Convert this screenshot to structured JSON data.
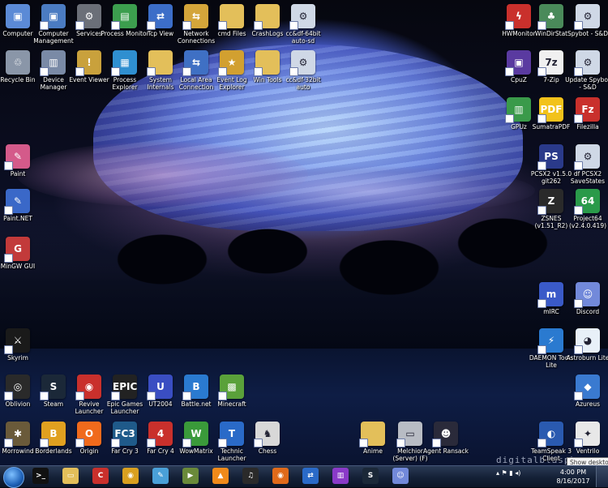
{
  "desktop": {
    "watermark": "digitalblasphe",
    "icons": [
      {
        "label": "Computer",
        "icon": "computer-icon",
        "color": "#5b8ad6",
        "glyph": "▣"
      },
      {
        "label": "Computer Management",
        "icon": "computer-management-icon",
        "color": "#4b7cc2",
        "glyph": "▣"
      },
      {
        "label": "Services",
        "icon": "gears-icon",
        "color": "#6b6f78",
        "glyph": "⚙"
      },
      {
        "label": "Process Monitor",
        "icon": "process-monitor-icon",
        "color": "#3c9e4e",
        "glyph": "▤"
      },
      {
        "label": "Tcp View",
        "icon": "network-icon",
        "color": "#3c6ec8",
        "glyph": "⇄"
      },
      {
        "label": "Network Connections",
        "icon": "network-connections-icon",
        "color": "#d4a53a",
        "glyph": "⇆"
      },
      {
        "label": "cmd Files",
        "icon": "folder-icon",
        "color": "#e3bf5a",
        "glyph": ""
      },
      {
        "label": "CrashLogs",
        "icon": "folder-icon",
        "color": "#e3bf5a",
        "glyph": ""
      },
      {
        "label": "cc&df-64bit auto-sd",
        "icon": "script-icon",
        "color": "#cfd8e6",
        "glyph": "⚙"
      },
      {
        "label": "Recycle Bin",
        "icon": "recycle-bin-icon",
        "color": "#8a96a8",
        "glyph": "♲"
      },
      {
        "label": "Device Manager",
        "icon": "device-manager-icon",
        "color": "#7a8aa6",
        "glyph": "▥"
      },
      {
        "label": "Event Viewer",
        "icon": "event-viewer-icon",
        "color": "#c9a13c",
        "glyph": "!"
      },
      {
        "label": "Process Explorer",
        "icon": "process-explorer-icon",
        "color": "#2f8fd0",
        "glyph": "▦"
      },
      {
        "label": "System Internals",
        "icon": "folder-icon",
        "color": "#e3bf5a",
        "glyph": ""
      },
      {
        "label": "Local Area Connection",
        "icon": "lan-icon",
        "color": "#3f70c4",
        "glyph": "⇆"
      },
      {
        "label": "Event Log Explorer",
        "icon": "event-log-icon",
        "color": "#d2a030",
        "glyph": "★"
      },
      {
        "label": "Win Tools",
        "icon": "folder-icon",
        "color": "#e3bf5a",
        "glyph": ""
      },
      {
        "label": "cc&df-32bit auto",
        "icon": "script-icon",
        "color": "#cfd8e6",
        "glyph": "⚙"
      },
      {
        "label": "Paint",
        "icon": "paint-icon",
        "color": "#d45a8a",
        "glyph": "✎"
      },
      {
        "label": "Paint.NET",
        "icon": "paintnet-icon",
        "color": "#3a68c8",
        "glyph": "✎"
      },
      {
        "label": "MinGW GUI",
        "icon": "mingw-icon",
        "color": "#c23a3a",
        "glyph": "G"
      },
      {
        "label": "Skyrim",
        "icon": "skyrim-icon",
        "color": "#1a1a1a",
        "glyph": "⚔"
      },
      {
        "label": "Oblivion",
        "icon": "oblivion-icon",
        "color": "#2a2a2a",
        "glyph": "◎"
      },
      {
        "label": "Steam",
        "icon": "steam-icon",
        "color": "#1b2838",
        "glyph": "S"
      },
      {
        "label": "Revive Launcher",
        "icon": "revive-icon",
        "color": "#c9302c",
        "glyph": "◉"
      },
      {
        "label": "Epic Games Launcher",
        "icon": "epic-icon",
        "color": "#222",
        "glyph": "EPIC"
      },
      {
        "label": "UT2004",
        "icon": "ut2004-icon",
        "color": "#3a4ec2",
        "glyph": "U"
      },
      {
        "label": "Battle.net",
        "icon": "battlenet-icon",
        "color": "#2a7ad0",
        "glyph": "B"
      },
      {
        "label": "Minecraft",
        "icon": "minecraft-icon",
        "color": "#5aa13a",
        "glyph": "▩"
      },
      {
        "label": "Morrowind",
        "icon": "morrowind-icon",
        "color": "#6a5a3a",
        "glyph": "✱"
      },
      {
        "label": "Borderlands",
        "icon": "borderlands-icon",
        "color": "#e0a020",
        "glyph": "B"
      },
      {
        "label": "Origin",
        "icon": "origin-icon",
        "color": "#f06a1c",
        "glyph": "O"
      },
      {
        "label": "Far Cry 3",
        "icon": "farcry3-icon",
        "color": "#1f5a8a",
        "glyph": "FC3"
      },
      {
        "label": "Far Cry 4",
        "icon": "farcry4-icon",
        "color": "#c9302c",
        "glyph": "4"
      },
      {
        "label": "WowMatrix",
        "icon": "wowmatrix-icon",
        "color": "#3a9a3a",
        "glyph": "W"
      },
      {
        "label": "Technic Launcher",
        "icon": "technic-icon",
        "color": "#2a6ac8",
        "glyph": "T"
      },
      {
        "label": "Chess",
        "icon": "chess-icon",
        "color": "#d8d8d8",
        "glyph": "♞"
      },
      {
        "label": "Anime",
        "icon": "folder-icon",
        "color": "#e3bf5a",
        "glyph": ""
      },
      {
        "label": "Melchior (Server) (F)",
        "icon": "drive-icon",
        "color": "#b8bcc4",
        "glyph": "▭"
      },
      {
        "label": "Agent Ransack",
        "icon": "agent-ransack-icon",
        "color": "#2a2a3a",
        "glyph": "☻"
      },
      {
        "label": "HWMonitor",
        "icon": "hwmonitor-icon",
        "color": "#c9302c",
        "glyph": "ϟ"
      },
      {
        "label": "WinDirStat",
        "icon": "windirstat-icon",
        "color": "#4a8a5a",
        "glyph": "♣"
      },
      {
        "label": "Spybot - S&D",
        "icon": "spybot-icon",
        "color": "#cfd8e6",
        "glyph": "⚙"
      },
      {
        "label": "CpuZ",
        "icon": "cpuz-icon",
        "color": "#5a3aa0",
        "glyph": "▣"
      },
      {
        "label": "7-Zip",
        "icon": "7zip-icon",
        "color": "#f0f0f0",
        "glyph": "7z"
      },
      {
        "label": "Update Spybot - S&D",
        "icon": "spybot-update-icon",
        "color": "#cfd8e6",
        "glyph": "⚙"
      },
      {
        "label": "GPUz",
        "icon": "gpuz-icon",
        "color": "#3a9a4a",
        "glyph": "▥"
      },
      {
        "label": "SumatraPDF",
        "icon": "sumatra-icon",
        "color": "#f2c21a",
        "glyph": "PDF"
      },
      {
        "label": "Filezilla",
        "icon": "filezilla-icon",
        "color": "#c9302c",
        "glyph": "Fz"
      },
      {
        "label": "PCSX2 v1.5.0 git262",
        "icon": "pcsx2-icon",
        "color": "#2a3a8a",
        "glyph": "PS"
      },
      {
        "label": "df PCSX2 SaveStates",
        "icon": "script-icon",
        "color": "#cfd8e6",
        "glyph": "⚙"
      },
      {
        "label": "ZSNES (v1.51_R2)",
        "icon": "zsnes-icon",
        "color": "#2a2a2a",
        "glyph": "Z"
      },
      {
        "label": "Project64 (v2.4.0.419)",
        "icon": "project64-icon",
        "color": "#2a9a4a",
        "glyph": "64"
      },
      {
        "label": "mIRC",
        "icon": "mirc-icon",
        "color": "#3a5ac8",
        "glyph": "m"
      },
      {
        "label": "Discord",
        "icon": "discord-icon",
        "color": "#7289da",
        "glyph": "☺"
      },
      {
        "label": "DAEMON Tools Lite",
        "icon": "daemon-tools-icon",
        "color": "#2a7ad0",
        "glyph": "⚡"
      },
      {
        "label": "Astroburn Lite",
        "icon": "astroburn-icon",
        "color": "#e8f0f8",
        "glyph": "◕"
      },
      {
        "label": "Azureus",
        "icon": "azureus-icon",
        "color": "#3a7ad0",
        "glyph": "◆"
      },
      {
        "label": "TeamSpeak 3 Client",
        "icon": "teamspeak-icon",
        "color": "#2a5ab0",
        "glyph": "◐"
      },
      {
        "label": "Ventrilo",
        "icon": "ventrilo-icon",
        "color": "#e8e8e8",
        "glyph": "✦"
      }
    ]
  },
  "taskbar": {
    "pinned": [
      {
        "icon": "cmd-icon",
        "color": "#111",
        "glyph": ">_"
      },
      {
        "icon": "explorer-icon",
        "color": "#e3bf5a",
        "glyph": "▭"
      },
      {
        "icon": "ccleaner-icon",
        "color": "#c9302c",
        "glyph": "C"
      },
      {
        "icon": "chrome-icon",
        "color": "#d9a020",
        "glyph": "◉"
      },
      {
        "icon": "notepad-icon",
        "color": "#4aa0d8",
        "glyph": "✎"
      },
      {
        "icon": "winamp-icon",
        "color": "#6a8a3a",
        "glyph": "▶"
      },
      {
        "icon": "vlc-icon",
        "color": "#f08a1a",
        "glyph": "▲"
      },
      {
        "icon": "foobar-icon",
        "color": "#2a2a2a",
        "glyph": "♫"
      },
      {
        "icon": "firefox-icon",
        "color": "#e06a1a",
        "glyph": "◉"
      },
      {
        "icon": "teamviewer-icon",
        "color": "#2a6ac8",
        "glyph": "⇄"
      },
      {
        "icon": "winrar-icon",
        "color": "#8a3ac8",
        "glyph": "▥"
      },
      {
        "icon": "steam-icon",
        "color": "#1b2838",
        "glyph": "S"
      },
      {
        "icon": "discord-icon",
        "color": "#7289da",
        "glyph": "☺"
      }
    ],
    "clock_time": "4:00 PM",
    "clock_date": "8/16/2017",
    "show_desktop_tooltip": "Show desktop"
  }
}
